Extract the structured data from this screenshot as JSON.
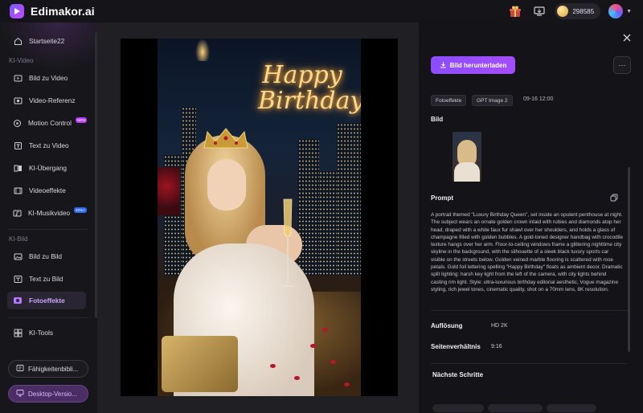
{
  "app": {
    "name": "Edimakor.ai"
  },
  "topbar": {
    "coin_count": "298585"
  },
  "sidebar": {
    "home": {
      "label": "Startseite22"
    },
    "section_video": "KI-Video",
    "video_items": [
      {
        "label": "Bild zu Video"
      },
      {
        "label": "Video-Referenz"
      },
      {
        "label": "Motion Control",
        "badge": "NEW"
      },
      {
        "label": "Text zu Video"
      },
      {
        "label": "KI-Übergang"
      },
      {
        "label": "Videoeffekte"
      },
      {
        "label": "KI-Musikvideo",
        "badge": "20%+"
      }
    ],
    "section_image": "KI-Bild",
    "image_items": [
      {
        "label": "Bild zu Bild"
      },
      {
        "label": "Text zu Bild"
      },
      {
        "label": "Fotoeffekte",
        "active": true
      }
    ],
    "tools": {
      "label": "KI-Tools"
    },
    "skills_button": "Fähigkeitenbibli...",
    "desktop_button": "Desktop-Versio...",
    "accent_color": "#c9a3ff"
  },
  "image": {
    "overlay_text_line1": "Happy",
    "overlay_text_line2": "Birthday"
  },
  "details": {
    "download_label": "Bild herunterladen",
    "more_label": "···",
    "tags": [
      "Fotoeffekte",
      "GPT Image 2"
    ],
    "date": "09-16 12:00",
    "image_title": "Bild",
    "prompt_title": "Prompt",
    "prompt_text": "A portrait themed \"Luxury Birthday Queen\", set inside an opulent penthouse at night. The subject wears an ornate golden crown inlaid with rubies and diamonds atop her head, draped with a white faux fur shawl over her shoulders, and holds a glass of champagne filled with golden bubbles. A gold-toned designer handbag with crocodile texture hangs over her arm. Floor-to-ceiling windows frame a glittering nighttime city skyline in the background, with the silhouette of a sleek black luxury sports car visible on the streets below. Golden veined marble flooring is scattered with rose petals. Gold foil lettering spelling \"Happy Birthday\" floats as ambient decor. Dramatic split lighting: harsh key light from the left of the camera, with city lights behind casting rim light. Style: ultra-luxurious birthday editorial aesthetic, Vogue magazine styling, rich jewel tones, cinematic quality, shot on a 70mm lens, 8K resolution.",
    "resolution_label": "Auflösung",
    "resolution_value": "HD 2K",
    "aspect_label": "Seitenverhältnis",
    "aspect_value": "9:16",
    "next_steps_title": "Nächste Schritte",
    "accent_color": "#8b4dff"
  }
}
